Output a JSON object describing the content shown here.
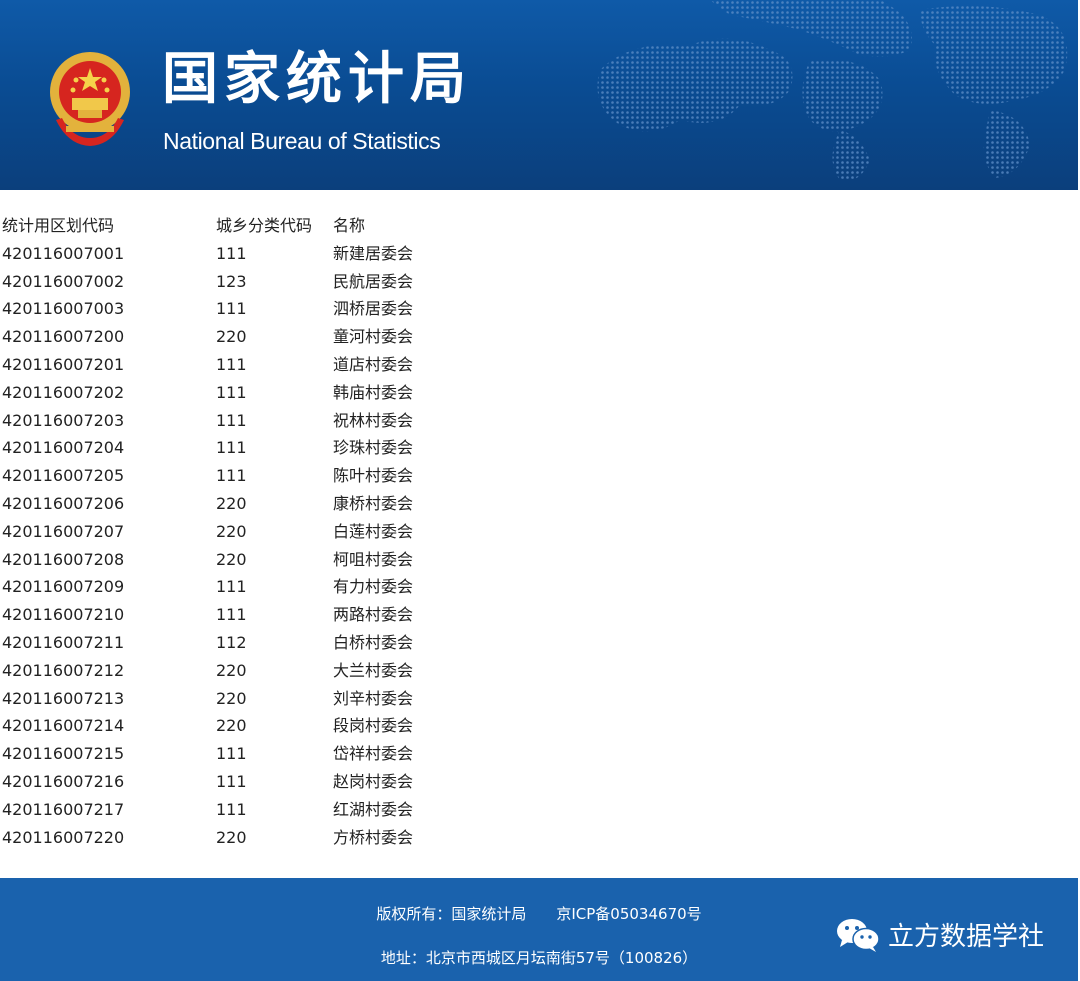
{
  "header": {
    "title_cn": "国家统计局",
    "title_en": "National Bureau of Statistics",
    "colors": {
      "banner": "#0a4c93",
      "footer": "#1a62ad"
    }
  },
  "table": {
    "headers": {
      "code": "统计用区划代码",
      "type": "城乡分类代码",
      "name": "名称"
    },
    "rows": [
      {
        "code": "420116007001",
        "type": "111",
        "name": "新建居委会"
      },
      {
        "code": "420116007002",
        "type": "123",
        "name": "民航居委会"
      },
      {
        "code": "420116007003",
        "type": "111",
        "name": "泗桥居委会"
      },
      {
        "code": "420116007200",
        "type": "220",
        "name": "童河村委会"
      },
      {
        "code": "420116007201",
        "type": "111",
        "name": "道店村委会"
      },
      {
        "code": "420116007202",
        "type": "111",
        "name": "韩庙村委会"
      },
      {
        "code": "420116007203",
        "type": "111",
        "name": "祝林村委会"
      },
      {
        "code": "420116007204",
        "type": "111",
        "name": "珍珠村委会"
      },
      {
        "code": "420116007205",
        "type": "111",
        "name": "陈叶村委会"
      },
      {
        "code": "420116007206",
        "type": "220",
        "name": "康桥村委会"
      },
      {
        "code": "420116007207",
        "type": "220",
        "name": "白莲村委会"
      },
      {
        "code": "420116007208",
        "type": "220",
        "name": "柯咀村委会"
      },
      {
        "code": "420116007209",
        "type": "111",
        "name": "有力村委会"
      },
      {
        "code": "420116007210",
        "type": "111",
        "name": "两路村委会"
      },
      {
        "code": "420116007211",
        "type": "112",
        "name": "白桥村委会"
      },
      {
        "code": "420116007212",
        "type": "220",
        "name": "大兰村委会"
      },
      {
        "code": "420116007213",
        "type": "220",
        "name": "刘辛村委会"
      },
      {
        "code": "420116007214",
        "type": "220",
        "name": "段岗村委会"
      },
      {
        "code": "420116007215",
        "type": "111",
        "name": "岱祥村委会"
      },
      {
        "code": "420116007216",
        "type": "111",
        "name": "赵岗村委会"
      },
      {
        "code": "420116007217",
        "type": "111",
        "name": "红湖村委会"
      },
      {
        "code": "420116007220",
        "type": "220",
        "name": "方桥村委会"
      }
    ]
  },
  "footer": {
    "copyright": "版权所有：国家统计局",
    "icp": "京ICP备05034670号",
    "address": "地址：北京市西城区月坛南街57号（100826）"
  },
  "watermark": {
    "text": "立方数据学社",
    "icon": "wechat-icon"
  }
}
